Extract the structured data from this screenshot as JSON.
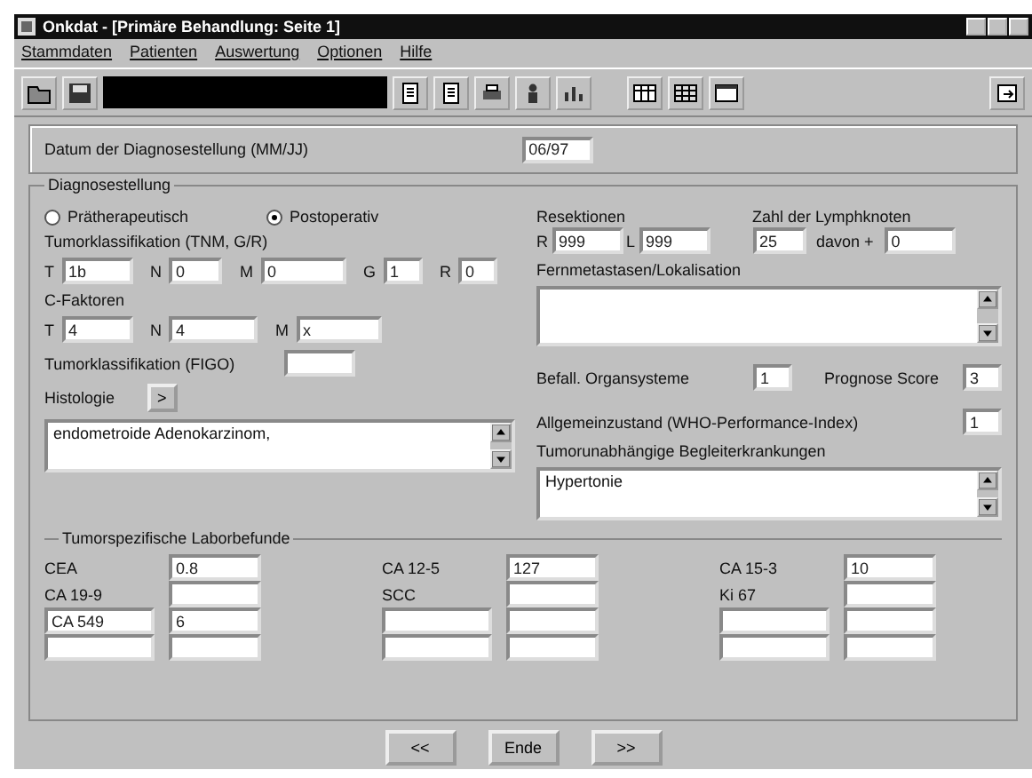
{
  "window": {
    "title": "Onkdat - [Primäre Behandlung: Seite 1]"
  },
  "menu": [
    "Stammdaten",
    "Patienten",
    "Auswertung",
    "Optionen",
    "Hilfe"
  ],
  "diagnosis_date": {
    "label": "Datum der Diagnosestellung (MM/JJ)",
    "value": "06/97"
  },
  "diagnosis": {
    "title": "Diagnosestellung",
    "radios": [
      {
        "label": "Prätherapeutisch",
        "selected": false
      },
      {
        "label": "Postoperativ",
        "selected": true
      }
    ],
    "tnm": {
      "label": "Tumorklassifikation (TNM, G/R)",
      "fields": [
        {
          "prefix": "T",
          "value": "1b"
        },
        {
          "prefix": "N",
          "value": "0"
        },
        {
          "prefix": "M",
          "value": "0"
        },
        {
          "prefix": "G",
          "value": "1"
        },
        {
          "prefix": "R",
          "value": "0"
        }
      ]
    },
    "c_factors": {
      "label": "C-Faktoren",
      "fields": [
        {
          "prefix": "T",
          "value": "4"
        },
        {
          "prefix": "N",
          "value": "4"
        },
        {
          "prefix": "M",
          "value": "x"
        }
      ]
    },
    "figo": {
      "label": "Tumorklassifikation (FIGO)"
    },
    "histology": {
      "label": "Histologie",
      "button": ">",
      "text": "endometroide Adenokarzinom,"
    },
    "resections": {
      "label": "Resektionen",
      "fields": [
        {
          "prefix": "R",
          "value": "999"
        },
        {
          "prefix": "L",
          "value": "999"
        }
      ]
    },
    "lymph_nodes": {
      "label": "Zahl der Lymphknoten",
      "value": "25",
      "positive_label": "davon +",
      "positive_value": "0"
    },
    "metastases": {
      "label": "Fernmetastasen/Lokalisation"
    },
    "organ_systems": {
      "label": "Befall. Organsysteme",
      "value": "1"
    },
    "prognosis": {
      "label": "Prognose Score",
      "value": "3"
    },
    "general_condition": {
      "label": "Allgemeinzustand (WHO-Performance-Index)",
      "value": "1"
    },
    "comorbidities": {
      "label": "Tumorunabhängige Begleiterkrankungen",
      "text": "Hypertonie"
    }
  },
  "lab": {
    "title": "Tumorspezifische Laborbefunde",
    "columns": [
      {
        "rows": [
          {
            "kind": "label",
            "name": "CEA",
            "value": "0.8"
          },
          {
            "kind": "label",
            "name": "CA 19-9"
          },
          {
            "kind": "field",
            "name": "CA 549",
            "value": "6"
          },
          {
            "kind": "field"
          }
        ]
      },
      {
        "rows": [
          {
            "kind": "label",
            "name": "CA 12-5",
            "value": "127"
          },
          {
            "kind": "label",
            "name": "SCC"
          },
          {
            "kind": "field"
          },
          {
            "kind": "field"
          }
        ]
      },
      {
        "rows": [
          {
            "kind": "label",
            "name": "CA 15-3",
            "value": "10"
          },
          {
            "kind": "label",
            "name": "Ki 67"
          },
          {
            "kind": "field"
          },
          {
            "kind": "field"
          }
        ]
      }
    ]
  },
  "nav": [
    "<<",
    "Ende",
    ">>"
  ]
}
